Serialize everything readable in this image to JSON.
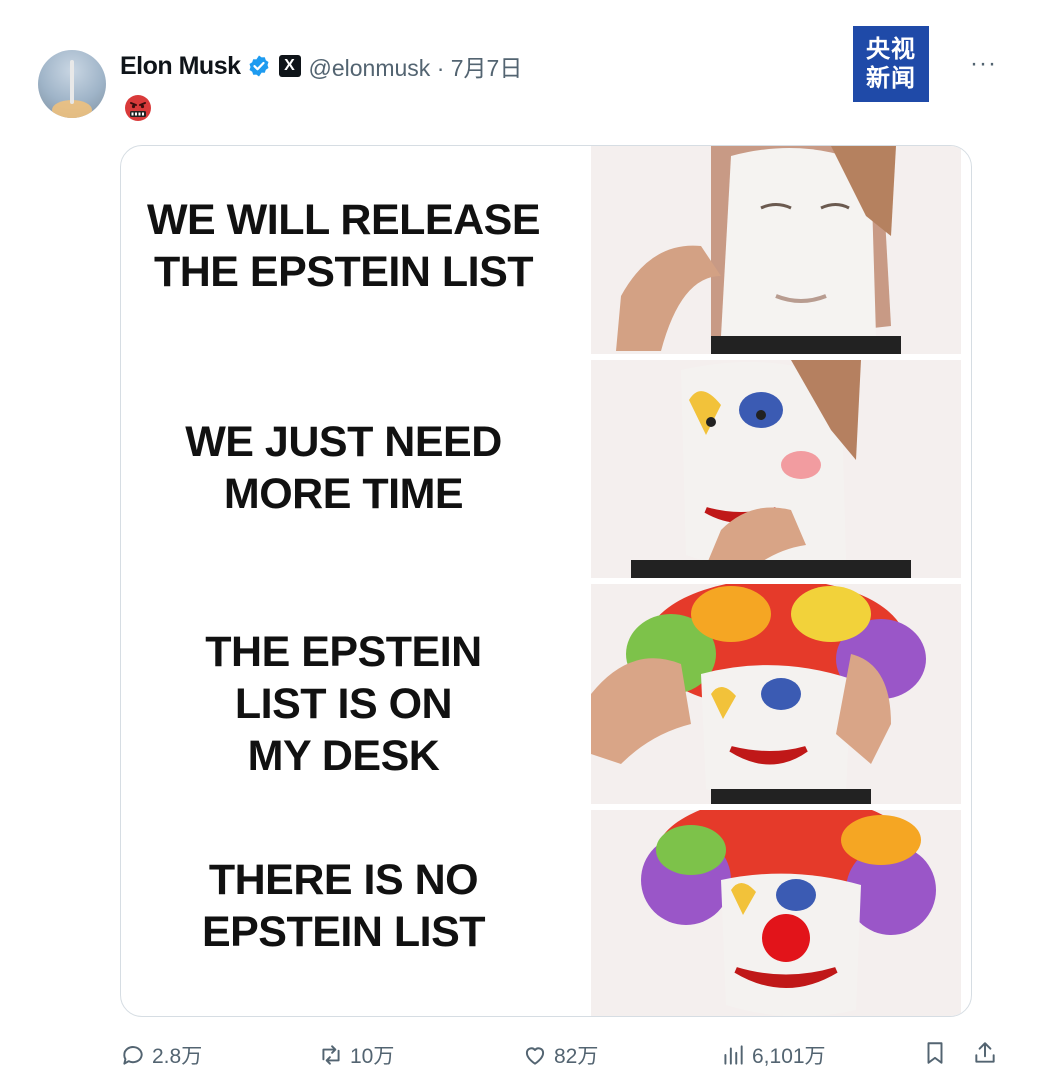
{
  "author": {
    "name": "Elon Musk",
    "handle": "@elonmusk · 7月7日",
    "avatar_icon": "avatar-rocket",
    "verified_icon": "verified-badge-icon",
    "affiliate_icon": "x-logo-icon",
    "x_glyph": "X"
  },
  "post": {
    "emoji": "cursing-face-emoji"
  },
  "watermark": {
    "line1": "央视",
    "line2": "新闻",
    "color": "#1f4aa8"
  },
  "menu": {
    "more_label": "···"
  },
  "meme": {
    "panels": [
      {
        "caption_line1": "WE WILL RELEASE",
        "caption_line2": "THE EPSTEIN LIST",
        "caption_line3": ""
      },
      {
        "caption_line1": "WE JUST NEED",
        "caption_line2": "MORE TIME",
        "caption_line3": ""
      },
      {
        "caption_line1": "THE EPSTEIN",
        "caption_line2": "LIST IS ON",
        "caption_line3": "MY DESK"
      },
      {
        "caption_line1": "THERE IS NO",
        "caption_line2": "EPSTEIN LIST",
        "caption_line3": ""
      }
    ]
  },
  "actions": {
    "replies": "2.8万",
    "reposts": "10万",
    "likes": "82万",
    "views": "6,101万"
  },
  "colors": {
    "text": "#0f1419",
    "muted": "#536471",
    "verified": "#1d9bf0"
  }
}
